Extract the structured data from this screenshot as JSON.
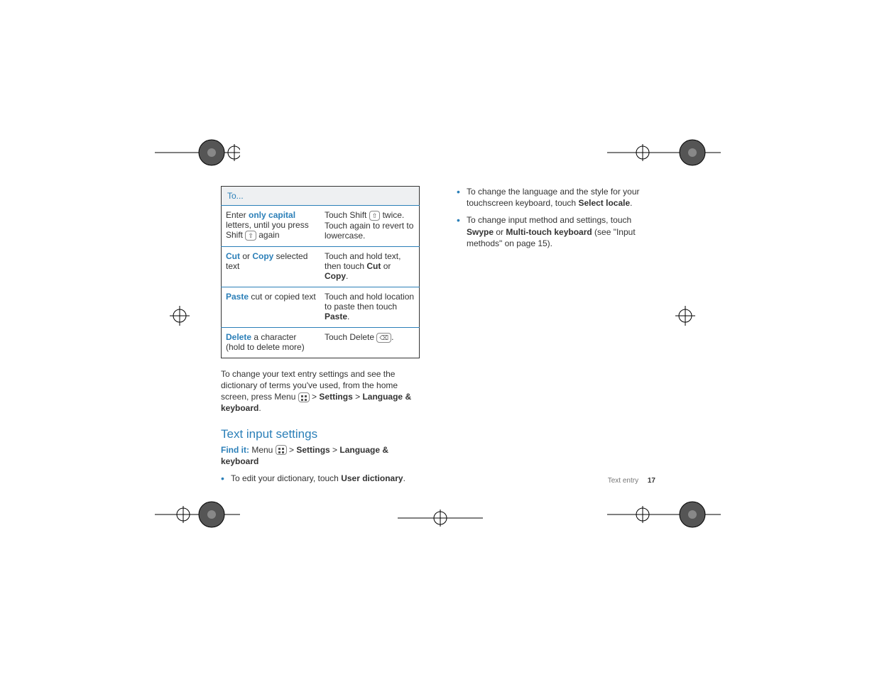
{
  "table": {
    "header": "To...",
    "rows": [
      {
        "left_pre": "Enter ",
        "left_hl": "only capital",
        "left_mid": " letters, until you press Shift ",
        "left_key": "⇧",
        "left_post": " again",
        "right_pre": "Touch Shift ",
        "right_key": "⇧",
        "right_post": " twice. Touch again to revert to lowercase."
      },
      {
        "left_hl1": "Cut",
        "left_mid1": " or ",
        "left_hl2": "Copy",
        "left_post": " selected text",
        "right_pre": "Touch and hold text, then touch ",
        "right_b1": "Cut",
        "right_mid": " or ",
        "right_b2": "Copy",
        "right_post": "."
      },
      {
        "left_hl": "Paste",
        "left_post": " cut or copied text",
        "right_pre": "Touch and hold location to paste then touch ",
        "right_b1": "Paste",
        "right_post": "."
      },
      {
        "left_hl": "Delete",
        "left_post": " a character (hold to delete more)",
        "right_pre": "Touch Delete ",
        "right_key": "⌫",
        "right_post": "."
      }
    ]
  },
  "para1_pre": "To change your text entry settings and see the dictionary of terms you've used, from the home screen, press Menu ",
  "para1_gt1": " > ",
  "para1_b1": "Settings",
  "para1_gt2": " > ",
  "para1_b2": "Language & keyboard",
  "para1_post": ".",
  "heading": "Text input settings",
  "findit_label": "Find it:",
  "findit_pre": " Menu ",
  "findit_gt1": " > ",
  "findit_b1": "Settings",
  "findit_gt2": " > ",
  "findit_b2": "Language & keyboard",
  "left_bullets": [
    {
      "pre": "To edit your dictionary, touch ",
      "b": "User dictionary",
      "post": "."
    }
  ],
  "right_bullets": [
    {
      "pre": "To change the language and the style for your touchscreen keyboard, touch ",
      "b": "Select locale",
      "post": "."
    },
    {
      "pre": "To change input method and settings, touch ",
      "b1": "Swype",
      "mid": " or ",
      "b2": "Multi-touch keyboard",
      "post": " (see \"Input methods\" on page 15)."
    }
  ],
  "footer_label": "Text entry",
  "footer_page": "17"
}
